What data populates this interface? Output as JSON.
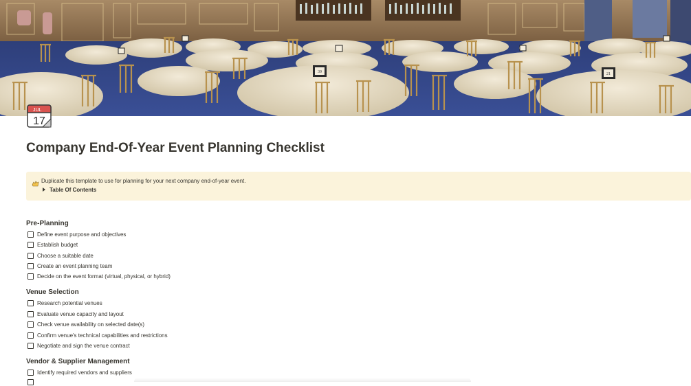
{
  "cover": {
    "description_icon": "banquet-hall-cover-image",
    "colors": {
      "wall": "#8a6a48",
      "floor": "#33478a",
      "tablecloth": "#e9dfca",
      "chair": "#b8924e"
    },
    "table_numbers": [
      "39",
      "21"
    ]
  },
  "page_icon": {
    "name": "calendar-icon",
    "month": "JUL",
    "day": "17"
  },
  "title": "Company End-Of-Year Event Planning Checklist",
  "callout": {
    "icon": "folded-hands-icon",
    "text": "Duplicate this template to use for planning for your next company end-of-year event.",
    "toggle_label": "Table Of Contents",
    "background": "#fbf3db"
  },
  "sections": [
    {
      "heading": "Pre-Planning",
      "items": [
        "Define event purpose and objectives",
        "Establish budget",
        "Choose a suitable date",
        "Create an event planning team",
        "Decide on the event format (virtual, physical, or hybrid)"
      ]
    },
    {
      "heading": "Venue Selection",
      "items": [
        "Research potential venues",
        "Evaluate venue capacity and layout",
        "Check venue availability on selected date(s)",
        "Confirm venue's technical capabilities and restrictions",
        "Negotiate and sign the venue contract"
      ]
    },
    {
      "heading": "Vendor & Supplier Management",
      "items": [
        "Identify required vendors and suppliers",
        ""
      ]
    }
  ]
}
